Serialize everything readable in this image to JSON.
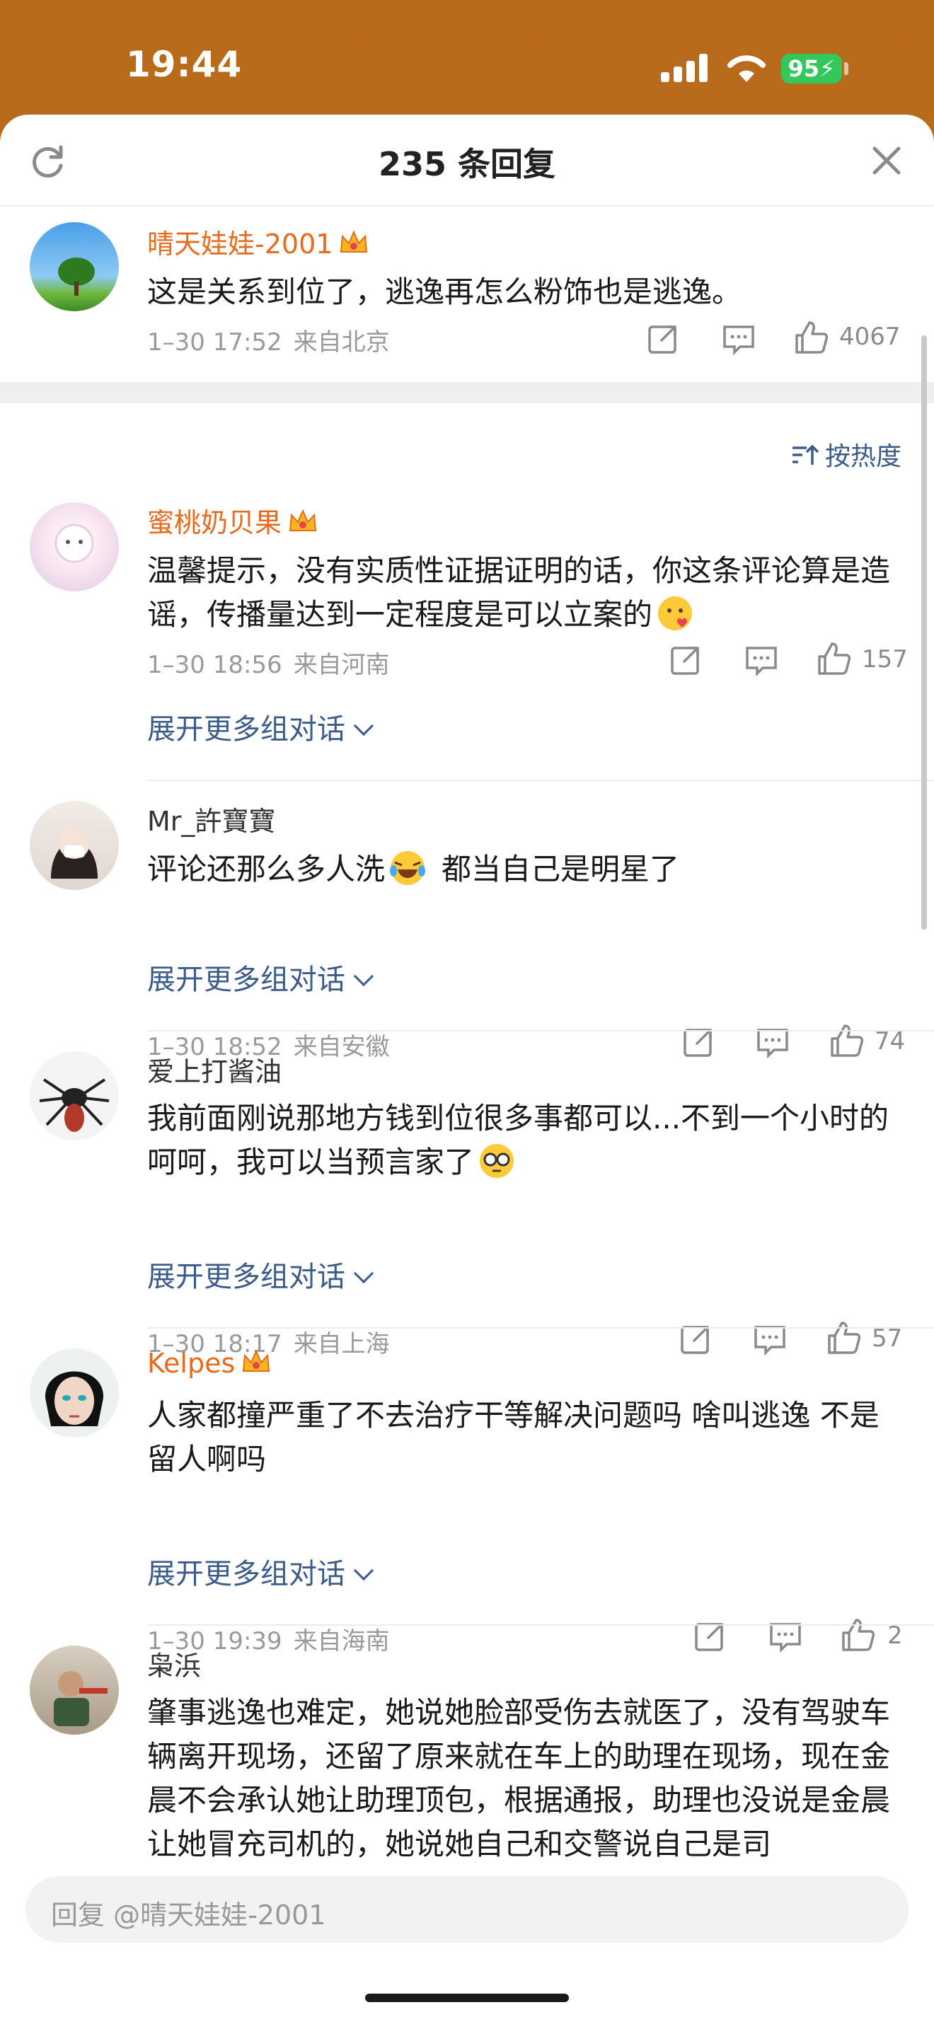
{
  "status": {
    "time": "19:44",
    "battery": "95"
  },
  "sheet": {
    "title": "235 条回复"
  },
  "top_comment": {
    "user": "晴天娃娃-2001",
    "text": "这是关系到位了，逃逸再怎么粉饰也是逃逸。",
    "date": "1–30 17:52",
    "location": "来自北京",
    "likes": "4067"
  },
  "sort": {
    "label": "按热度"
  },
  "replies": [
    {
      "user": "蜜桃奶贝果",
      "text": "温馨提示，没有实质性证据证明的话，你这条评论算是造谣，传播量达到一定程度是可以立案的",
      "date": "1–30 18:56",
      "location": "来自河南",
      "likes": "157",
      "expand": "展开更多组对话"
    },
    {
      "user": "Mr_許寶寶",
      "text_a": "评论还那么多人洗",
      "text_b": "都当自己是明星了",
      "date": "1–30 18:52",
      "location": "来自安徽",
      "likes": "74",
      "expand": "展开更多组对话"
    },
    {
      "user": "爱上打酱油",
      "text": "我前面刚说那地方钱到位很多事都可以...不到一个小时的呵呵，我可以当预言家了",
      "date": "1–30 18:17",
      "location": "来自上海",
      "likes": "57",
      "expand": "展开更多组对话"
    },
    {
      "user": "Kelpes",
      "text": "人家都撞严重了不去治疗干等解决问题吗 啥叫逃逸 不是留人啊吗",
      "date": "1–30 19:39",
      "location": "来自海南",
      "likes": "2",
      "expand": "展开更多组对话"
    },
    {
      "user": "枭浜",
      "text": "肇事逃逸也难定，她说她脸部受伤去就医了，没有驾驶车辆离开现场，还留了原来就在车上的助理在现场，现在金晨不会承认她让助理顶包，根据通报，助理也没说是金晨让她冒充司机的，她说她自己和交警说自己是司"
    }
  ],
  "reply_bar": {
    "placeholder": "回复 @晴天娃娃-2001"
  },
  "colors": {
    "vip_name": "#e86a1c",
    "link": "#3b5b8a",
    "meta": "#9a9a9a"
  }
}
